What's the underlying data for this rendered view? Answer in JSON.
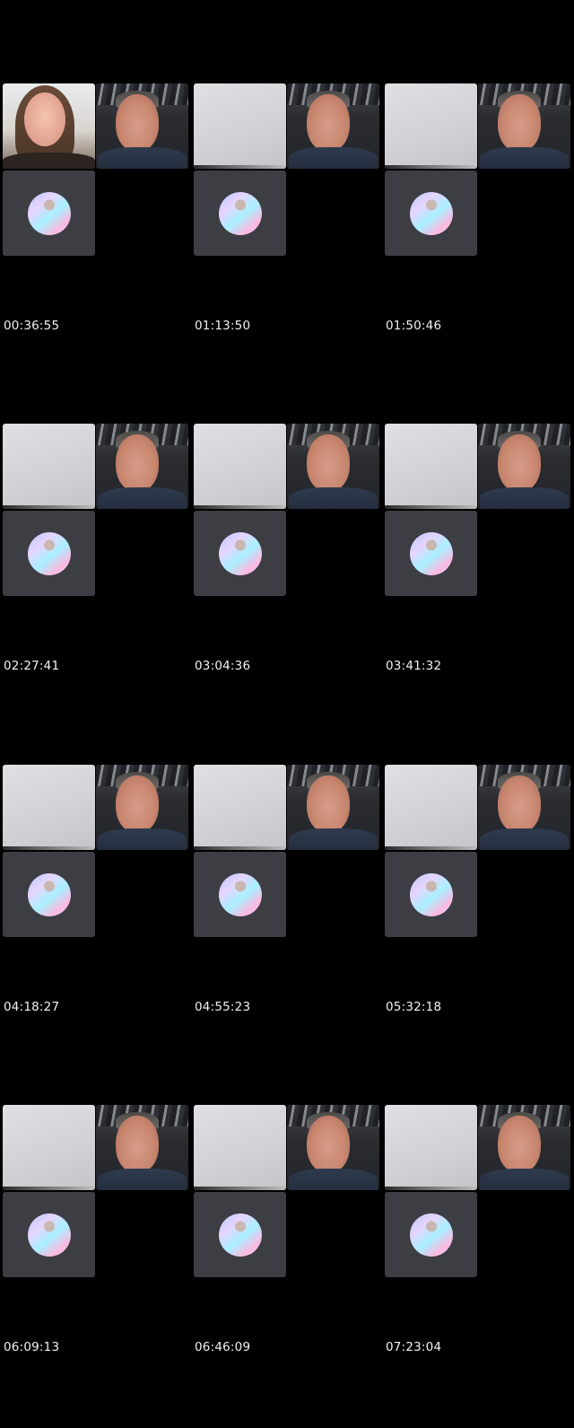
{
  "contact_sheet": {
    "frames": [
      {
        "timestamp": "00:36:55",
        "first_tile": "woman"
      },
      {
        "timestamp": "01:13:50",
        "first_tile": "gray"
      },
      {
        "timestamp": "01:50:46",
        "first_tile": "gray"
      },
      {
        "timestamp": "02:27:41",
        "first_tile": "gray"
      },
      {
        "timestamp": "03:04:36",
        "first_tile": "gray"
      },
      {
        "timestamp": "03:41:32",
        "first_tile": "gray"
      },
      {
        "timestamp": "04:18:27",
        "first_tile": "gray"
      },
      {
        "timestamp": "04:55:23",
        "first_tile": "gray"
      },
      {
        "timestamp": "05:32:18",
        "first_tile": "gray"
      },
      {
        "timestamp": "06:09:13",
        "first_tile": "gray"
      },
      {
        "timestamp": "06:46:09",
        "first_tile": "gray"
      },
      {
        "timestamp": "07:23:04",
        "first_tile": "gray"
      }
    ]
  },
  "colors": {
    "background": "#000000",
    "tile_dark": "#3d3d44",
    "timestamp_text": "#f2f2f2"
  }
}
